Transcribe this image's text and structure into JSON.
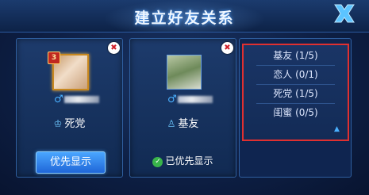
{
  "header": {
    "title": "建立好友关系"
  },
  "cards": [
    {
      "level": "3",
      "relation_label": "死党",
      "action_label": "优先显示"
    },
    {
      "relation_label": "基友",
      "status_label": "已优先显示"
    }
  ],
  "relation_list": {
    "items": [
      {
        "label": "基友 (1/5)"
      },
      {
        "label": "恋人 (0/1)"
      },
      {
        "label": "死党 (1/5)"
      },
      {
        "label": "闺蜜 (0/5)"
      }
    ]
  },
  "colors": {
    "accent": "#4ab0ff",
    "highlight_border": "#e03030",
    "remove": "#d0202a",
    "success": "#39b44a"
  },
  "icons": {
    "close": "close-icon",
    "remove": "remove-icon",
    "gender": "male-icon",
    "scroll": "scroll-up-icon"
  }
}
